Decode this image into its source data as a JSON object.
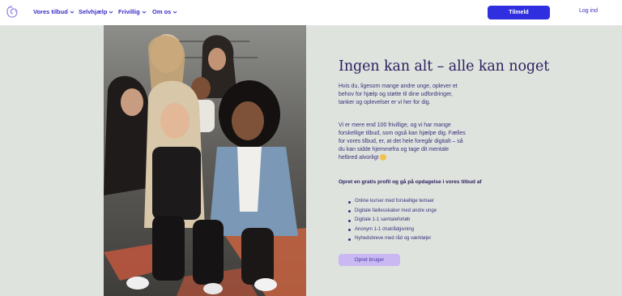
{
  "nav": {
    "items": [
      {
        "label": "Vores tilbud"
      },
      {
        "label": "Selvhjælp"
      },
      {
        "label": "Frivillig"
      },
      {
        "label": "Om os"
      }
    ],
    "signup_label": "Tilmeld",
    "login_label": "Log ind"
  },
  "hero": {
    "headline": "Ingen kan alt – alle kan noget",
    "paragraph1": "Hvis du, ligesom mange andre unge, oplever et behov for hjælp og støtte til dine udfordringer, tanker og oplevelser er vi her for dig.",
    "paragraph2": "Vi er mere end 100 frivillige, og vi har mange forskellige tilbud, som også kan hjælpe dig. Fælles for vores tilbud, er, at det hele foregår digitalt – så du kan sidde hjemmefra og tage dit mentale helbred alvorligt",
    "offers_heading": "Opret en gratis profil og gå på opdagelse i vores tilbud af",
    "offers": [
      "Online kurser med forskellige temaer",
      "Digitale fællesskaber med andre unge",
      "Digitale 1-1 samtaleforløb",
      "Anonym 1-1 chatrådgivning",
      "Nyhedsbreve med råd og værktøjer"
    ],
    "create_user_label": "Opret bruger"
  },
  "icons": {
    "logo": "swirl-logo-icon",
    "dropdown": "chevron-down-icon",
    "emoji": "smiling-face-emoji-icon"
  },
  "colors": {
    "page_background": "#dfe3de",
    "nav_link": "#3b2cc8",
    "primary_button": "#2f2fe0",
    "secondary_button": "#c9b8f2",
    "heading_text": "#2c2160"
  }
}
